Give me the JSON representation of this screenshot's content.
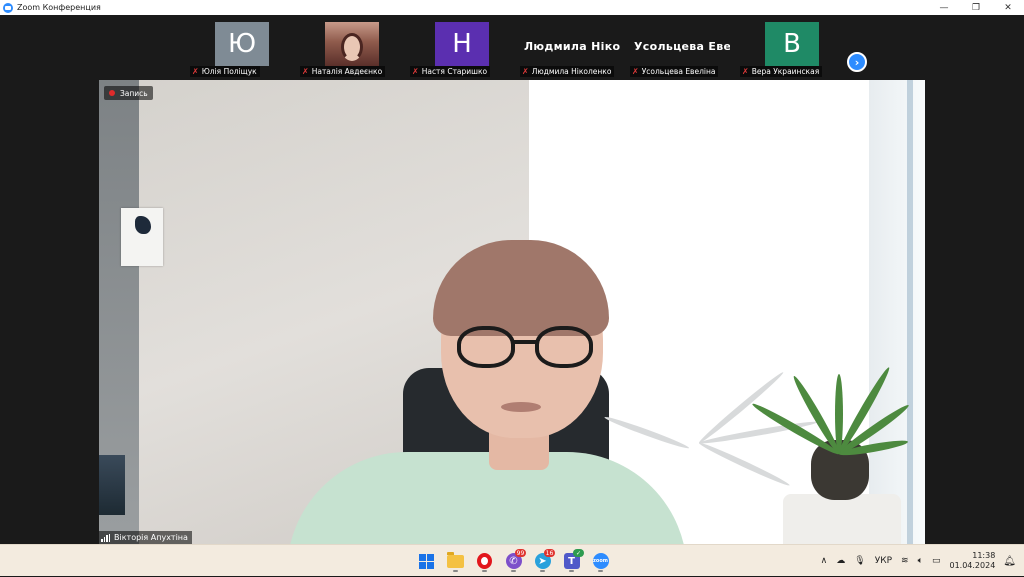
{
  "window": {
    "title": "Zoom Конференция",
    "controls": {
      "minimize": "—",
      "restore": "❐",
      "close": "✕"
    }
  },
  "participants": [
    {
      "name": "Юлія Поліщук",
      "initial": "Ю",
      "avatar_color": "#7f8b95",
      "muted": true
    },
    {
      "name": "Наталія Авдеєнко",
      "initial": "",
      "avatar_color": "#7a4a40",
      "muted": true,
      "photo": true
    },
    {
      "name": "Настя Старишко",
      "initial": "Н",
      "avatar_color": "#5b2fb0",
      "muted": true
    },
    {
      "name": "Людмила Ніколенко",
      "display_name": "Людмила Ніко...",
      "muted": true
    },
    {
      "name": "Усольцева Евеліна",
      "display_name": "Усольцева Еве...",
      "muted": true
    },
    {
      "name": "Вера Украинская",
      "initial": "В",
      "avatar_color": "#1f8a66",
      "muted": true
    }
  ],
  "next_page_icon": "›",
  "recording": {
    "label": "Запись",
    "color": "#e02b2b"
  },
  "speaker": {
    "name": "Вікторія Апухтіна"
  },
  "taskbar": {
    "apps": [
      {
        "name": "start",
        "badge": ""
      },
      {
        "name": "file-explorer",
        "badge": ""
      },
      {
        "name": "opera",
        "badge": ""
      },
      {
        "name": "viber",
        "badge": "99"
      },
      {
        "name": "telegram",
        "badge": "16"
      },
      {
        "name": "teams",
        "badge": "✓"
      },
      {
        "name": "zoom",
        "badge": ""
      }
    ],
    "tray": {
      "chevron": "∧",
      "language": "УКР",
      "time": "11:38",
      "date": "01.04.2024"
    }
  },
  "colors": {
    "accent": "#2d8cff",
    "taskbar_bg": "#f3ebdf",
    "muted_icon": "#e23b3b"
  }
}
